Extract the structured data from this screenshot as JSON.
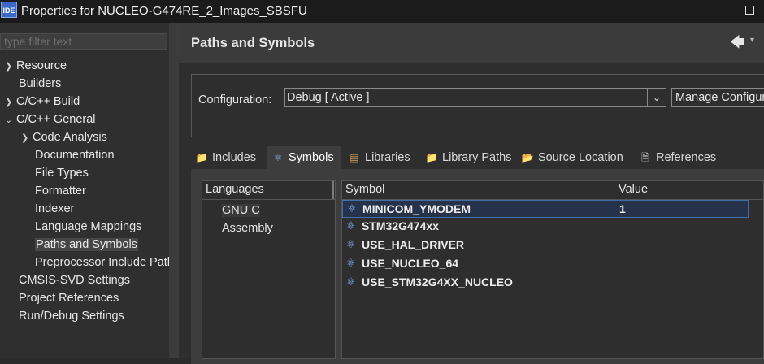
{
  "window": {
    "icon_text": "IDE",
    "title": "Properties for NUCLEO-G474RE_2_Images_SBSFU"
  },
  "sidebar": {
    "filter_placeholder": "type filter text",
    "items": [
      {
        "label": "Resource",
        "expandable": true
      },
      {
        "label": "Builders"
      },
      {
        "label": "C/C++ Build",
        "expandable": true
      },
      {
        "label": "C/C++ General",
        "expanded": true
      },
      {
        "label": "Code Analysis",
        "expandable": true
      },
      {
        "label": "Documentation"
      },
      {
        "label": "File Types"
      },
      {
        "label": "Formatter"
      },
      {
        "label": "Indexer"
      },
      {
        "label": "Language Mappings"
      },
      {
        "label": "Paths and Symbols",
        "selected": true
      },
      {
        "label": "Preprocessor Include Path"
      },
      {
        "label": "CMSIS-SVD Settings"
      },
      {
        "label": "Project References"
      },
      {
        "label": "Run/Debug Settings"
      }
    ]
  },
  "page": {
    "title": "Paths and Symbols"
  },
  "configuration": {
    "label": "Configuration:",
    "value": "Debug  [ Active ]",
    "manage_label": "Manage Configurations..."
  },
  "tabs": [
    {
      "label": "Includes",
      "icon": "includes-icon"
    },
    {
      "label": "Symbols",
      "icon": "symbols-icon",
      "active": true
    },
    {
      "label": "Libraries",
      "icon": "libraries-icon"
    },
    {
      "label": "Library Paths",
      "icon": "library-paths-icon"
    },
    {
      "label": "Source Location",
      "icon": "source-location-icon"
    },
    {
      "label": "References",
      "icon": "references-icon"
    }
  ],
  "languages": {
    "header": "Languages",
    "items": [
      "GNU C",
      "Assembly"
    ],
    "selected": "GNU C"
  },
  "symbols_table": {
    "columns": [
      "Symbol",
      "Value"
    ],
    "rows": [
      {
        "symbol": "MINICOM_YMODEM",
        "value": "1",
        "selected": true
      },
      {
        "symbol": "STM32G474xx",
        "value": ""
      },
      {
        "symbol": "USE_HAL_DRIVER",
        "value": ""
      },
      {
        "symbol": "USE_NUCLEO_64",
        "value": ""
      },
      {
        "symbol": "USE_STM32G4XX_NUCLEO",
        "value": ""
      }
    ]
  },
  "colors": {
    "background": "#2b2b2b",
    "selection": "#26324a",
    "symbol_icon": "#8fb3ff"
  }
}
